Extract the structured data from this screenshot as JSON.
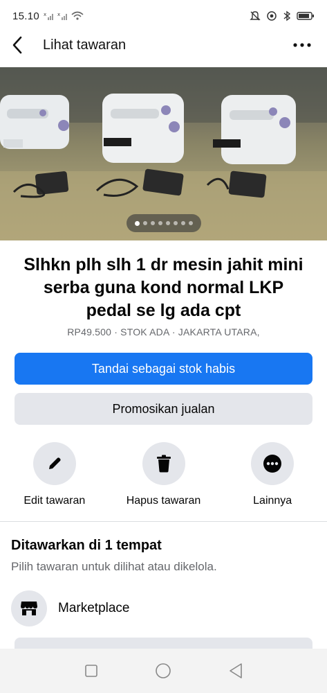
{
  "status_bar": {
    "time": "15.10",
    "icons": [
      "signal-icon",
      "signal-icon",
      "wifi-icon",
      "mute-icon",
      "data-saver-icon",
      "bluetooth-icon",
      "battery-icon"
    ]
  },
  "header": {
    "title": "Lihat tawaran",
    "back_icon": "back-arrow-icon",
    "more_icon": "more-dots-icon"
  },
  "photo": {
    "image_count": 8,
    "current_index": 1
  },
  "listing": {
    "title": "Slhkn plh slh 1 dr mesin jahit mini serba guna kond normal LKP pedal se lg ada cpt",
    "meta": "RP49.500 · STOK ADA · JAKARTA UTARA,"
  },
  "buttons": {
    "mark_sold": "Tandai sebagai stok habis",
    "promote": "Promosikan jualan"
  },
  "actions": [
    {
      "label": "Edit tawaran",
      "icon": "pencil-icon"
    },
    {
      "label": "Hapus tawaran",
      "icon": "trash-icon"
    },
    {
      "label": "Lainnya",
      "icon": "more-horizontal-icon"
    }
  ],
  "section": {
    "title": "Ditawarkan di 1 tempat",
    "subtitle": "Pilih tawaran untuk dilihat atau dikelola.",
    "places": [
      {
        "label": "Marketplace",
        "icon": "marketplace-store-icon"
      }
    ]
  },
  "colors": {
    "primary": "#1877f2",
    "secondary_bg": "#e4e6eb",
    "muted_text": "#65676b"
  }
}
